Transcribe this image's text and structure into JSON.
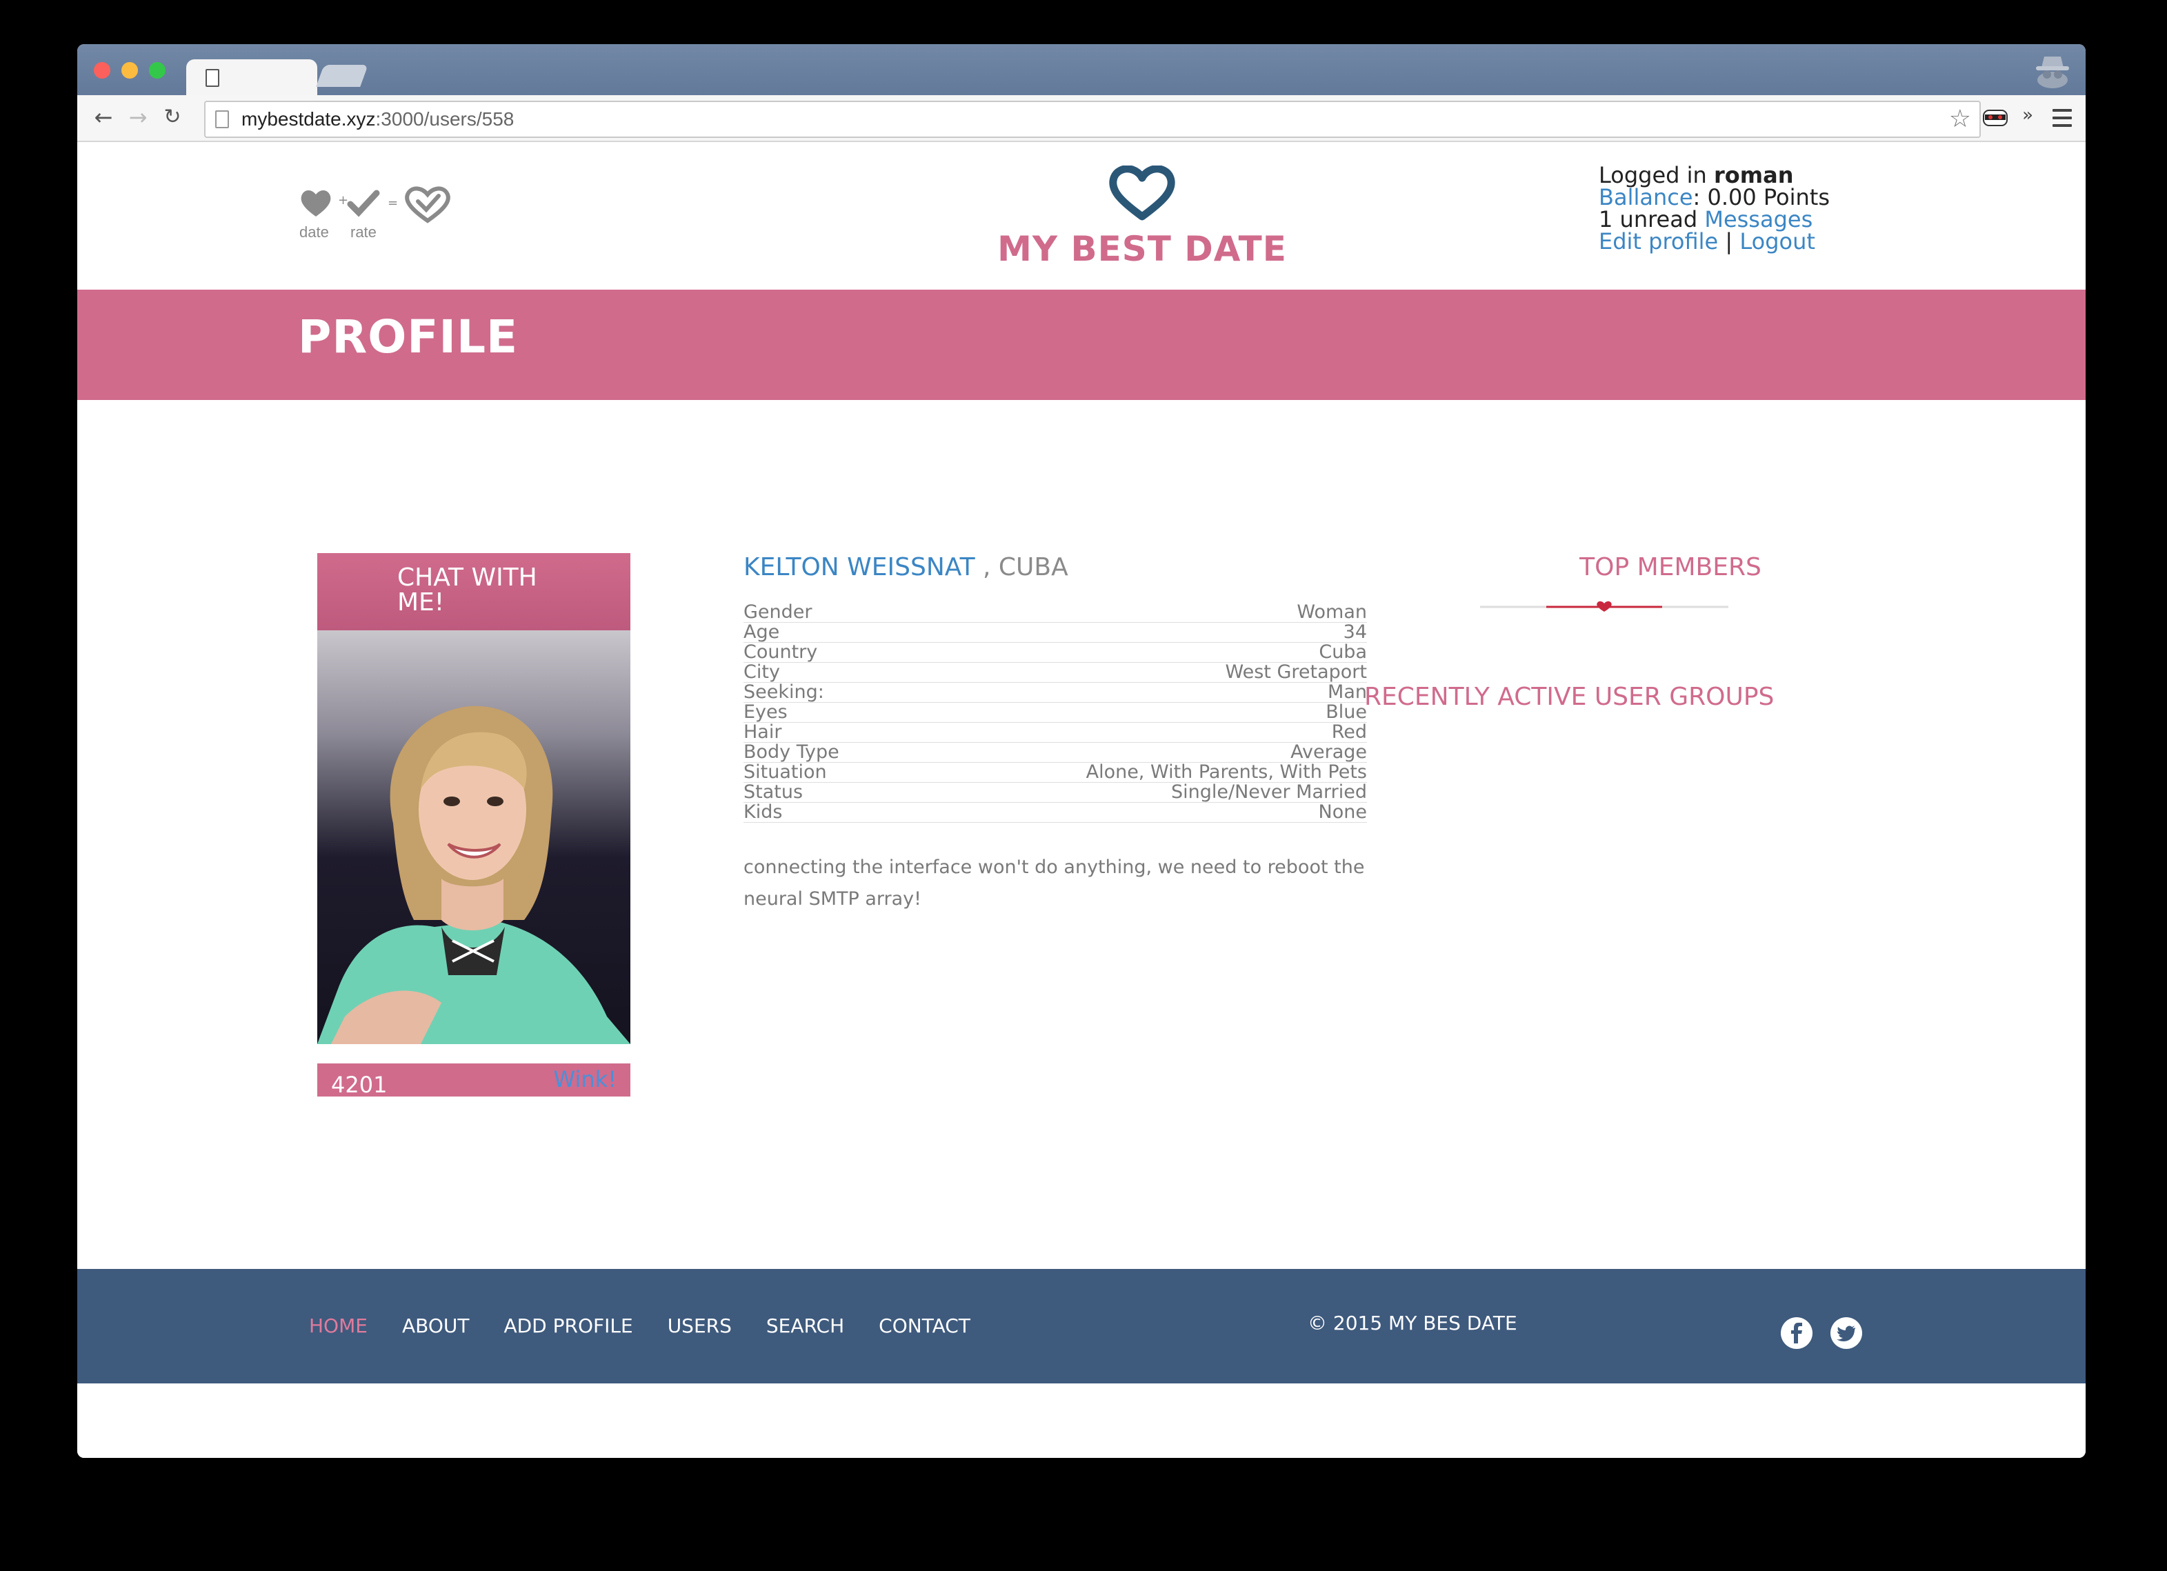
{
  "browser": {
    "url_host": "mybestdate.xyz",
    "url_path": ":3000/users/558"
  },
  "header": {
    "small_logo": {
      "label_date": "date",
      "label_rate": "rate"
    },
    "brand_title": "MY BEST DATE",
    "user": {
      "logged_in_prefix": "Logged in",
      "username": "roman",
      "balance_label": "Ballance",
      "balance_value": ": 0.00 Points",
      "unread_prefix": "1 unread",
      "messages_link": "Messages",
      "edit_profile": "Edit profile",
      "separator": "|",
      "logout": "Logout"
    }
  },
  "banner": {
    "title": "PROFILE"
  },
  "card": {
    "chat_label": "CHAT WITH ME!",
    "number": "4201",
    "wink": "Wink!"
  },
  "profile": {
    "name": "KELTON WEISSNAT",
    "country_suffix": ", CUBA",
    "attributes": [
      {
        "label": "Gender",
        "value": "Woman"
      },
      {
        "label": "Age",
        "value": "34"
      },
      {
        "label": "Country",
        "value": "Cuba"
      },
      {
        "label": "City",
        "value": "West Gretaport"
      },
      {
        "label": "Seeking:",
        "value": "Man"
      },
      {
        "label": "Eyes",
        "value": "Blue"
      },
      {
        "label": "Hair",
        "value": "Red"
      },
      {
        "label": "Body Type",
        "value": "Average"
      },
      {
        "label": "Situation",
        "value": "Alone, With Parents, With Pets"
      },
      {
        "label": "Status",
        "value": "Single/Never Married"
      },
      {
        "label": "Kids",
        "value": "None"
      }
    ],
    "bio": "connecting the interface won't do anything, we need to reboot the neural SMTP array!"
  },
  "sidebar": {
    "top_members": "TOP MEMBERS",
    "recent_groups": "RECENTLY ACTIVE USER GROUPS"
  },
  "footer": {
    "nav": [
      {
        "label": "HOME",
        "active": true
      },
      {
        "label": "ABOUT",
        "active": false
      },
      {
        "label": "ADD PROFILE",
        "active": false
      },
      {
        "label": "USERS",
        "active": false
      },
      {
        "label": "SEARCH",
        "active": false
      },
      {
        "label": "CONTACT",
        "active": false
      }
    ],
    "copyright": "© 2015 MY BES DATE"
  },
  "colors": {
    "brand_pink": "#d06b8c",
    "footer_navy": "#3e5a7d",
    "link_blue": "#3b86c4",
    "logo_navy": "#2b5777"
  }
}
